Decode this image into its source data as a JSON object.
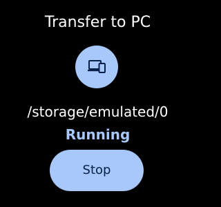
{
  "header": {
    "title": "Transfer to PC"
  },
  "transfer": {
    "icon": "devices-icon",
    "path": "/storage/emulated/0",
    "status": "Running"
  },
  "actions": {
    "stop_label": "Stop"
  },
  "colors": {
    "background": "#000000",
    "accent": "#a8c7fa",
    "accent_text": "#06204a",
    "status_text": "#a8c7fa",
    "primary_text": "#ffffff"
  }
}
